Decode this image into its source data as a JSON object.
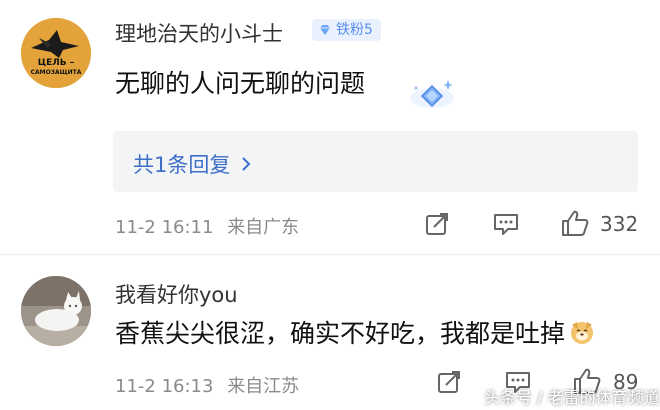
{
  "comments": [
    {
      "username": "理地治天的小斗士",
      "badge": "铁粉5",
      "avatar_text_line1": "ЦЕЛЬ –",
      "avatar_text_line2": "САМОЗАЩИТА",
      "content": "无聊的人问无聊的问题",
      "replies_label": "共1条回复",
      "date": "11-2 16:11",
      "location": "来自广东",
      "like_count": "332"
    },
    {
      "username": "我看好你you",
      "content": "香蕉尖尖很涩，确实不好吃，我都是吐掉",
      "date": "11-2 16:13",
      "location": "来自江苏",
      "like_count": "89"
    }
  ],
  "watermark": "头条号 / 老雷的体育频道",
  "icons": {
    "share": "share-icon",
    "comment": "comment-icon",
    "like": "thumbs-up-icon",
    "badge": "diamond-icon",
    "chevron": "chevron-right-icon",
    "emoji": "dog-emoji-icon"
  },
  "colors": {
    "link": "#3e6fc6",
    "badge_text": "#5a8ff0",
    "badge_bg": "#e9f1fe",
    "reply_bg": "#f3f4f6",
    "meta": "#8a8a8a"
  }
}
